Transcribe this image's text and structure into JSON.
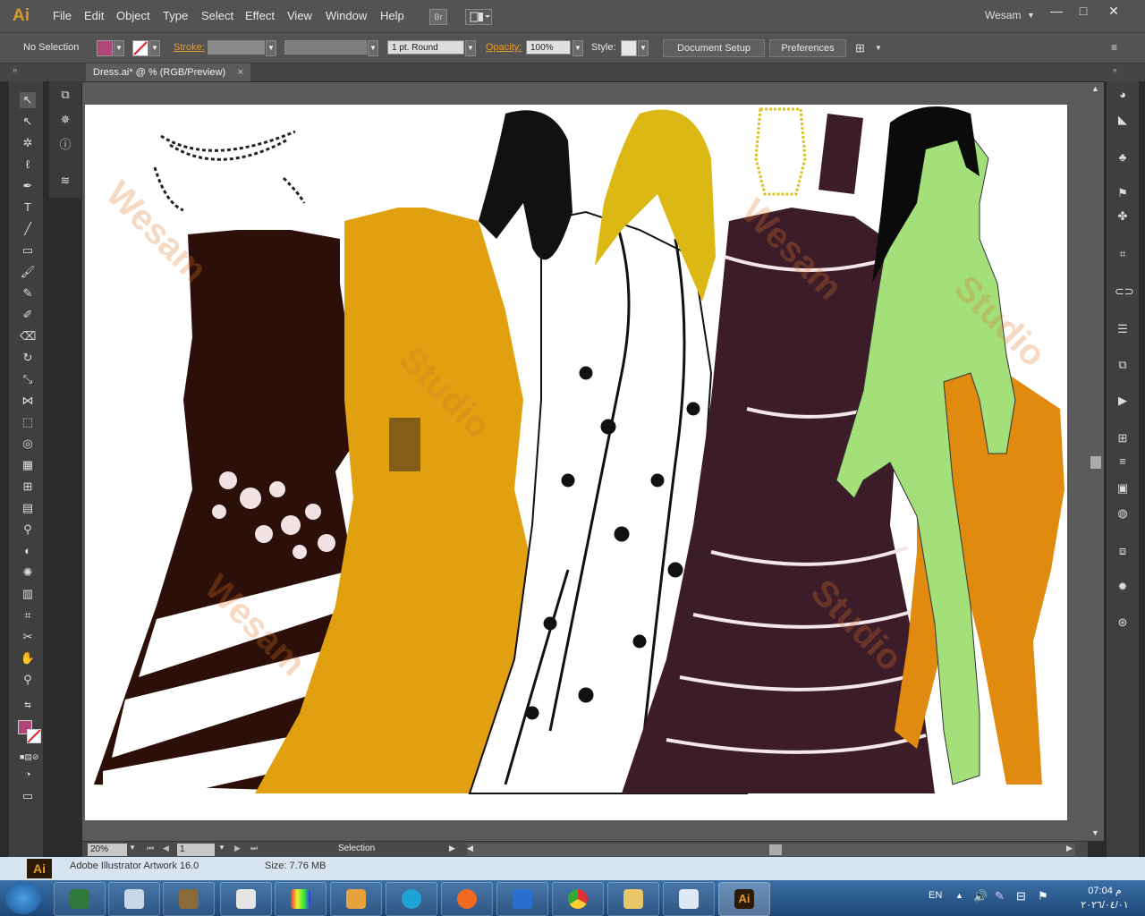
{
  "app": {
    "logo": "Ai",
    "user": "Wesam",
    "bridge_label": "Br"
  },
  "menu": [
    "File",
    "Edit",
    "Object",
    "Type",
    "Select",
    "Effect",
    "View",
    "Window",
    "Help"
  ],
  "window_controls": {
    "minimize": "—",
    "maximize": "□",
    "close": "✕"
  },
  "control_bar": {
    "selection_label": "No Selection",
    "fill_color": "#b0457a",
    "stroke_label": "Stroke:",
    "stroke_profile": "1 pt. Round",
    "opacity_label": "Opacity:",
    "opacity_value": "100%",
    "style_label": "Style:",
    "document_setup": "Document Setup",
    "preferences": "Preferences"
  },
  "document": {
    "tab_title": "Dress.ai* @ % (RGB/Preview)",
    "tab_close": "×"
  },
  "status_bar": {
    "zoom": "20%",
    "artboard": "1",
    "tool_status": "Selection"
  },
  "file_strip": {
    "name": "Adobe Illustrator Artwork 16.0",
    "size": "Size: 7.76 MB"
  },
  "taskbar": {
    "language": "EN",
    "time": "07:04 م",
    "date": "٢٠٢٦/٠٤/٠١",
    "apps": [
      "windows-start",
      "task-manager",
      "drawing-tool",
      "gimp",
      "paint",
      "studio",
      "pdf-viewer",
      "edge",
      "firefox",
      "maxthon",
      "chrome",
      "file-explorer",
      "document-viewer",
      "illustrator"
    ]
  },
  "watermark_text": [
    "Wesam",
    "Studio"
  ],
  "colors": {
    "accent_orange": "#e49a2a",
    "dress_brown": "#2b0f08",
    "dress_gold": "#e0a010",
    "dress_plum": "#3d1c2a",
    "skin_green": "#a3e07a",
    "pants_orange": "#e08a10"
  }
}
